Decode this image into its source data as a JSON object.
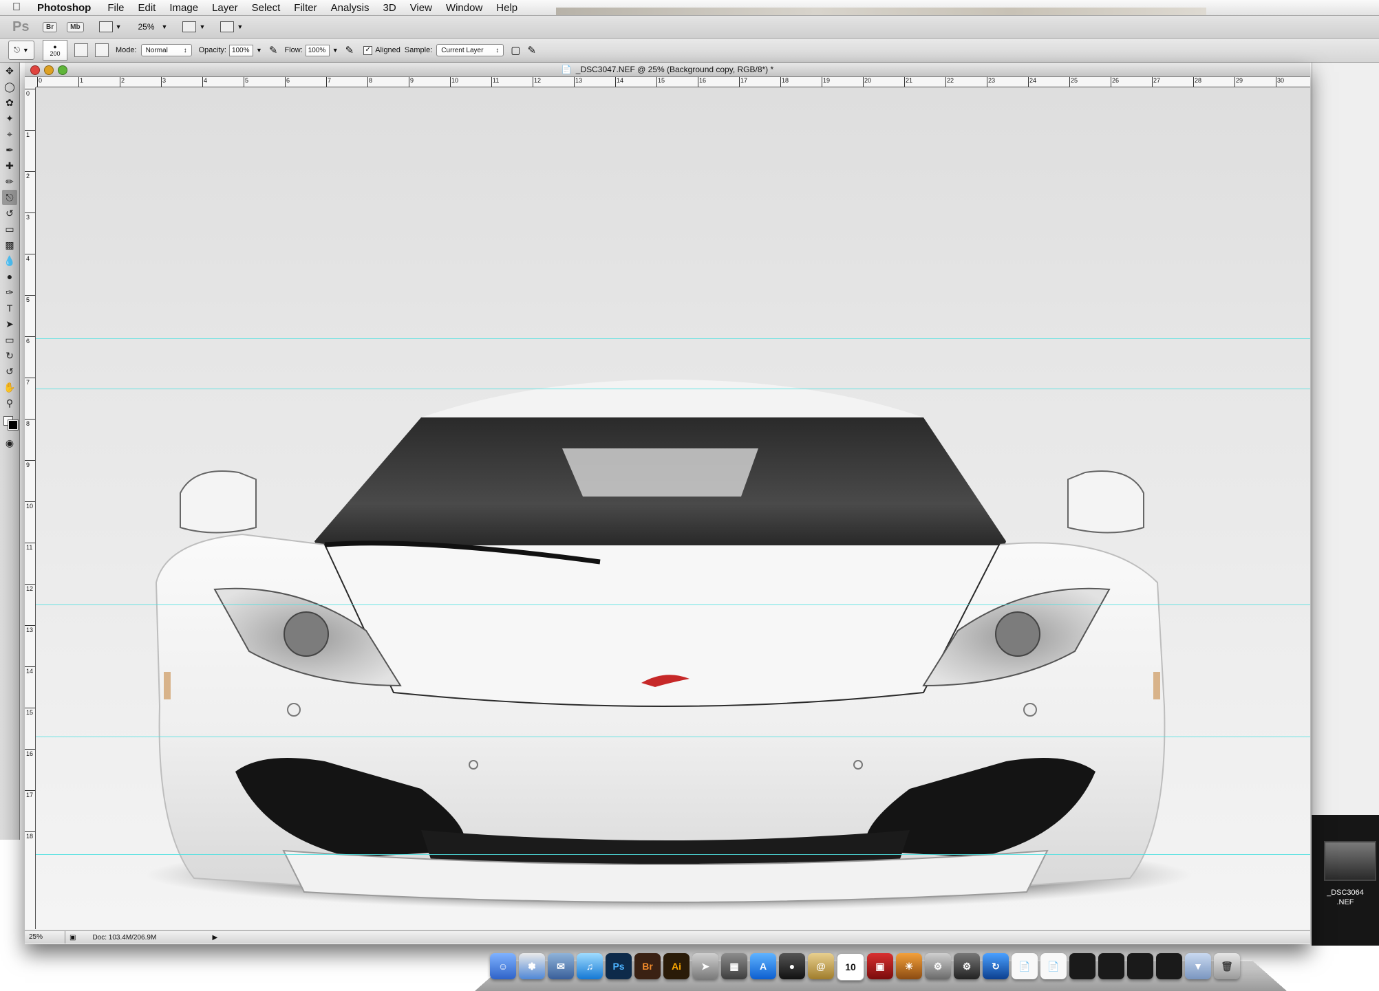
{
  "menubar": {
    "app_name": "Photoshop",
    "items": [
      "File",
      "Edit",
      "Image",
      "Layer",
      "Select",
      "Filter",
      "Analysis",
      "3D",
      "View",
      "Window",
      "Help"
    ]
  },
  "appbar": {
    "logo": "Ps",
    "bridge": "Br",
    "mini_bridge": "Mb",
    "zoom": "25%"
  },
  "options": {
    "brush_size": "200",
    "mode_label": "Mode:",
    "mode_value": "Normal",
    "opacity_label": "Opacity:",
    "opacity_value": "100%",
    "flow_label": "Flow:",
    "flow_value": "100%",
    "aligned_label": "Aligned",
    "aligned_checked": true,
    "sample_label": "Sample:",
    "sample_value": "Current Layer"
  },
  "document": {
    "title": "_DSC3047.NEF @ 25% (Background copy, RGB/8*) *",
    "ruler_top": [
      "0",
      "1",
      "2",
      "3",
      "4",
      "5",
      "6",
      "7",
      "8",
      "9",
      "10",
      "11",
      "12",
      "13",
      "14",
      "15",
      "16",
      "17",
      "18",
      "19",
      "20",
      "21",
      "22",
      "23",
      "24",
      "25",
      "26",
      "27",
      "28",
      "29",
      "30"
    ],
    "ruler_left": [
      "0",
      "1",
      "2",
      "3",
      "4",
      "5",
      "6",
      "7",
      "8",
      "9",
      "10",
      "11",
      "12",
      "13",
      "14",
      "15",
      "16",
      "17",
      "18"
    ],
    "status_zoom": "25%",
    "status_doc": "Doc: 103.4M/206.9M"
  },
  "filmstrip": {
    "thumb_name_1": "_DSC3064",
    "thumb_name_2": ".NEF"
  },
  "dock": {
    "photoshop": "Ps",
    "bridge": "Br",
    "illustrator": "Ai",
    "calendar_day": "10"
  },
  "colors": {
    "guide": "#4fe0e0",
    "foreground": "#000000",
    "background": "#ffffff"
  }
}
